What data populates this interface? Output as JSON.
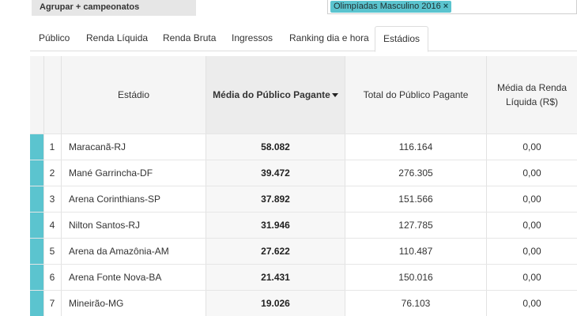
{
  "toolbar": {
    "group_label": "Agrupar + campeonatos",
    "filter_tag": "Olimpíadas Masculino 2016",
    "filter_remove": "×"
  },
  "tabs": [
    {
      "label": "Público",
      "active": false
    },
    {
      "label": "Renda Líquida",
      "active": false
    },
    {
      "label": "Renda Bruta",
      "active": false
    },
    {
      "label": "Ingressos",
      "active": false
    },
    {
      "label": "Ranking dia e hora",
      "active": false
    },
    {
      "label": "Estádios",
      "active": true
    }
  ],
  "table": {
    "headers": {
      "stadium": "Estádio",
      "avg_paying": "Média do Público Pagante",
      "total_paying": "Total do Público Pagante",
      "avg_net_income": "Média da Renda Líquida (R$)"
    },
    "sorted_column": "avg_paying",
    "accent_color": "#5bc4cf",
    "rows": [
      {
        "rank": "1",
        "stadium": "Maracanã-RJ",
        "avg": "58.082",
        "total": "116.164",
        "income": "0,00"
      },
      {
        "rank": "2",
        "stadium": "Mané Garrincha-DF",
        "avg": "39.472",
        "total": "276.305",
        "income": "0,00"
      },
      {
        "rank": "3",
        "stadium": "Arena Corinthians-SP",
        "avg": "37.892",
        "total": "151.566",
        "income": "0,00"
      },
      {
        "rank": "4",
        "stadium": "Nilton Santos-RJ",
        "avg": "31.946",
        "total": "127.785",
        "income": "0,00"
      },
      {
        "rank": "5",
        "stadium": "Arena da Amazônia-AM",
        "avg": "27.622",
        "total": "110.487",
        "income": "0,00"
      },
      {
        "rank": "6",
        "stadium": "Arena Fonte Nova-BA",
        "avg": "21.431",
        "total": "150.016",
        "income": "0,00"
      },
      {
        "rank": "7",
        "stadium": "Mineirão-MG",
        "avg": "19.026",
        "total": "76.103",
        "income": "0,00"
      }
    ]
  }
}
